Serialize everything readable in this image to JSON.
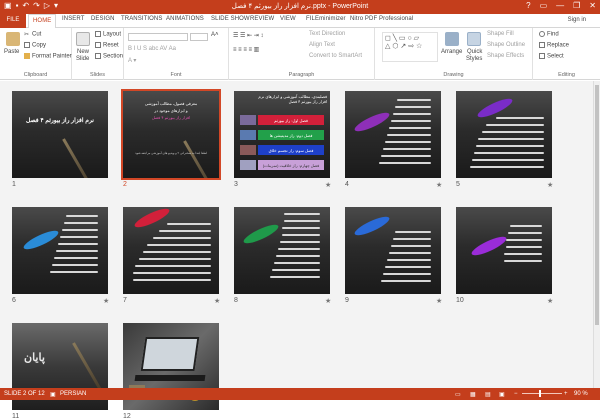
{
  "window": {
    "title": "نرم افزار راز بیورثم ۴ فصل.pptx - PowerPoint",
    "controls": [
      "?",
      "▭",
      "—",
      "❐",
      "✕"
    ]
  },
  "ribbon_tabs": [
    {
      "label": "FILE"
    },
    {
      "label": "HOME"
    },
    {
      "label": "INSERT"
    },
    {
      "label": "DESIGN"
    },
    {
      "label": "TRANSITIONS"
    },
    {
      "label": "ANIMATIONS"
    },
    {
      "label": "SLIDE SHOW"
    },
    {
      "label": "REVIEW"
    },
    {
      "label": "VIEW"
    },
    {
      "label": "FILEminimizer"
    },
    {
      "label": "Nitro PDF Professional"
    }
  ],
  "account": {
    "signin": "Sign in"
  },
  "clipboard": {
    "paste": "Paste",
    "cut": "Cut",
    "copy": "Copy",
    "format_painter": "Format Painter",
    "group": "Clipboard"
  },
  "slides_group": {
    "new_slide": "New",
    "new_slide_2": "Slide",
    "layout": "Layout",
    "reset": "Reset",
    "section": "Section",
    "group": "Slides"
  },
  "font_group": {
    "group": "Font"
  },
  "paragraph_group": {
    "text_direction": "Text Direction",
    "align_text": "Align Text",
    "convert": "Convert to SmartArt",
    "group": "Paragraph"
  },
  "drawing_group": {
    "arrange": "Arrange",
    "quick_styles": "Quick",
    "quick_styles_2": "Styles",
    "shape_fill": "Shape Fill",
    "shape_outline": "Shape Outline",
    "shape_effects": "Shape Effects",
    "group": "Drawing"
  },
  "editing_group": {
    "find": "Find",
    "replace": "Replace",
    "select": "Select",
    "group": "Editing"
  },
  "slides": [
    {
      "number": "1",
      "title": "نرم افزار راز بیورثم ۴ فصل"
    },
    {
      "number": "2",
      "lines": [
        "معرفی فصول، مطالب آموزشی",
        "و ابزارهای موجود در",
        "افزار راز بیورثم ۴ فصل",
        "لطفا ابتدا به سخنرانی ۲ و ویدیو های آموزشی مراجعه شود"
      ]
    },
    {
      "number": "3",
      "lines": [
        "فصلبندی، مطالب آموزشی و ابزارهای نرم",
        "افزار راز بیورثم ۴ فصل"
      ],
      "bars": [
        "فصل اول: راز بیورثم",
        "فصل دوم: راز مدیتیشن ها",
        "فصل سوم: راز تجسم خلاق",
        "فصل چهارم: راز خلاقیت (تمرینات)"
      ]
    },
    {
      "number": "4"
    },
    {
      "number": "5"
    },
    {
      "number": "6"
    },
    {
      "number": "7"
    },
    {
      "number": "8"
    },
    {
      "number": "9"
    },
    {
      "number": "10"
    },
    {
      "number": "11",
      "title": "پایان"
    },
    {
      "number": "12"
    }
  ],
  "status": {
    "slide": "SLIDE 2 OF 12",
    "language": "PERSIAN",
    "zoom": "90 %"
  }
}
